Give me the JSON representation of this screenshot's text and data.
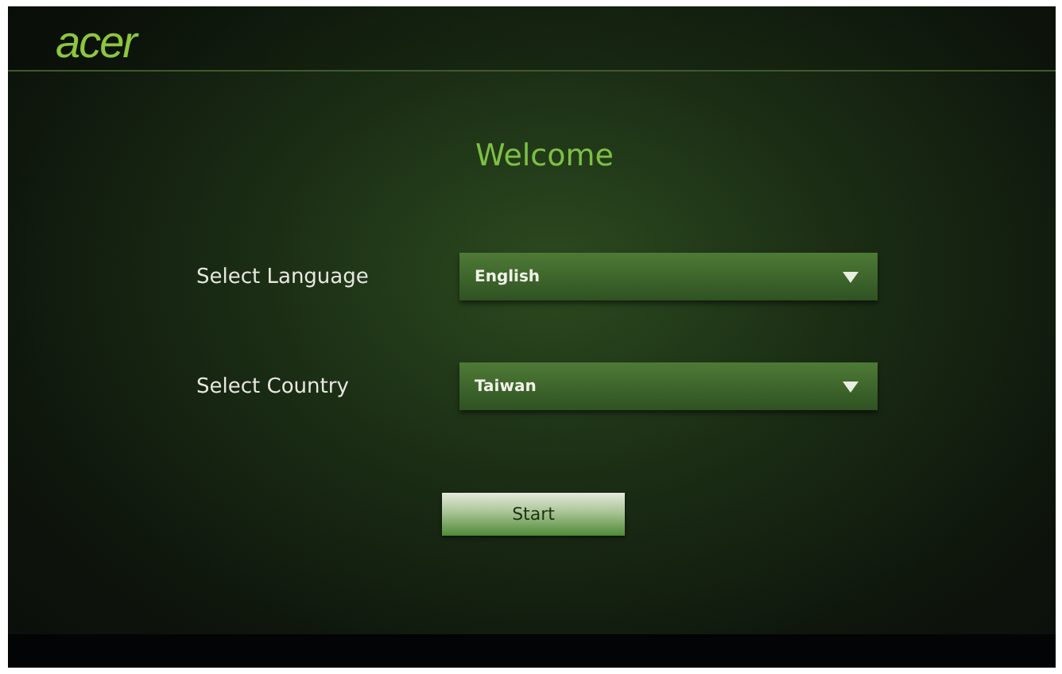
{
  "header": {
    "logo": "acer"
  },
  "title": "Welcome",
  "fields": [
    {
      "label": "Select Language",
      "value": "English"
    },
    {
      "label": "Select Country",
      "value": "Taiwan"
    }
  ],
  "start_button": "Start"
}
